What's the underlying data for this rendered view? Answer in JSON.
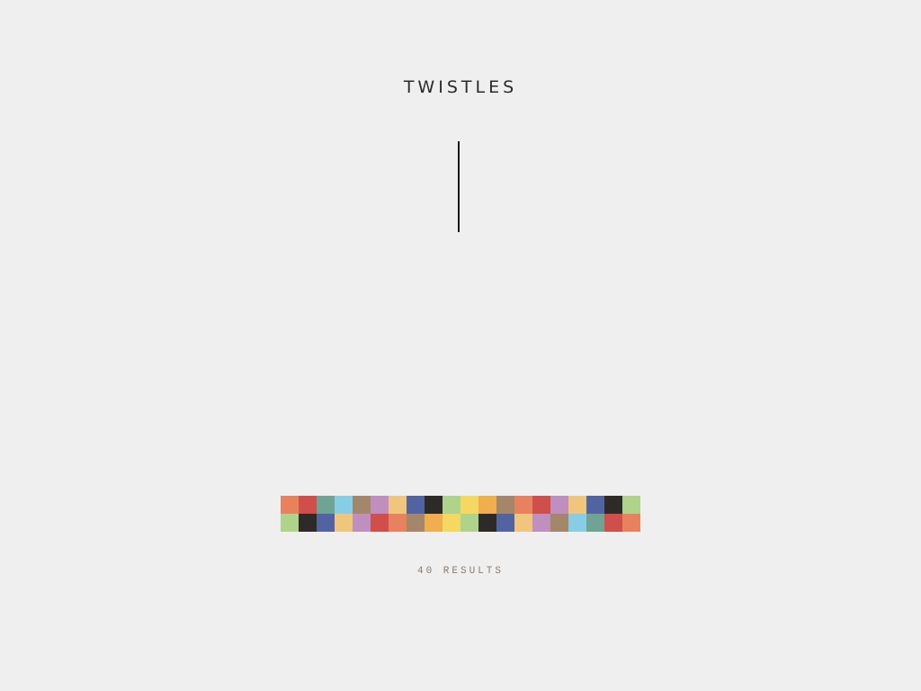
{
  "header": {
    "title": "TWISTLES"
  },
  "swatches": {
    "row1": [
      "#e8825e",
      "#cf4f4a",
      "#6fa395",
      "#87cee5",
      "#a4876a",
      "#c18ec0",
      "#f0c67c",
      "#5263a1",
      "#2e2a28",
      "#b0d38b",
      "#f5d862",
      "#f0ae4e",
      "#a4876a",
      "#e8825e",
      "#cf4f4a",
      "#c18ec0",
      "#f0c67c",
      "#5263a1",
      "#2e2a28",
      "#b0d38b"
    ],
    "row2": [
      "#b0d38b",
      "#2e2a28",
      "#5263a1",
      "#f0c67c",
      "#c18ec0",
      "#cf4f4a",
      "#e8825e",
      "#a4876a",
      "#f0ae4e",
      "#f5d862",
      "#b0d38b",
      "#2e2a28",
      "#5263a1",
      "#f0c67c",
      "#c18ec0",
      "#a4876a",
      "#87cee5",
      "#6fa395",
      "#cf4f4a",
      "#e8825e"
    ]
  },
  "results": {
    "label": "40 RESULTS"
  }
}
